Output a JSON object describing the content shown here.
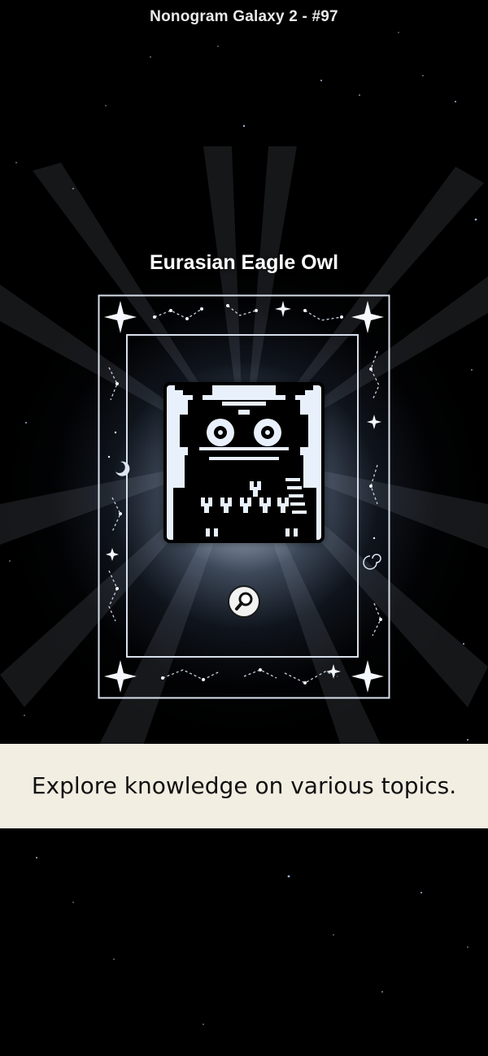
{
  "header": {
    "title": "Nonogram Galaxy 2 - #97"
  },
  "card": {
    "name": "Eurasian Eagle Owl"
  },
  "banner": {
    "text": "Explore knowledge on various topics."
  },
  "icons": {
    "zoom": "magnifier-icon"
  },
  "colors": {
    "background": "#000000",
    "banner": "#f3eee2",
    "frame": "#d8e0ec",
    "puzzle_light": "#e8f0fb"
  }
}
